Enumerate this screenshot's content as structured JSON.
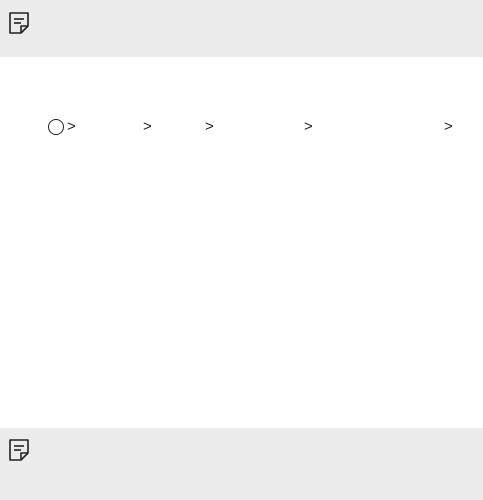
{
  "notes": {
    "top": {
      "icon": "note-icon"
    },
    "bottom": {
      "icon": "note-icon"
    }
  },
  "breadcrumb": {
    "home_icon": "circle-home-icon",
    "separators": [
      ">",
      ">",
      ">",
      ">",
      ">"
    ]
  }
}
